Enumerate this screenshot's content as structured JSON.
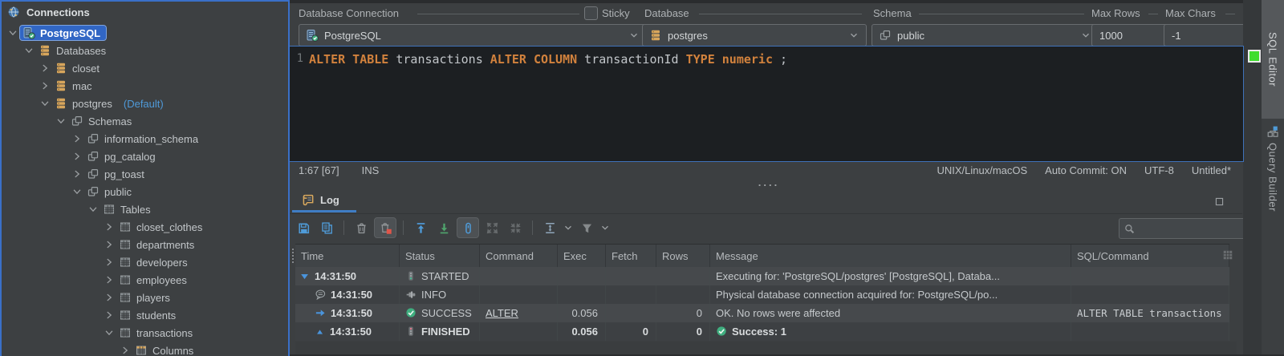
{
  "sidebar": {
    "title": "Connections",
    "tree": [
      {
        "label": "PostgreSQL",
        "indent": 0,
        "expand": "open",
        "icon": "connection",
        "selected": true
      },
      {
        "label": "Databases",
        "indent": 1,
        "expand": "open",
        "icon": "database"
      },
      {
        "label": "closet",
        "indent": 2,
        "expand": "closed",
        "icon": "database"
      },
      {
        "label": "mac",
        "indent": 2,
        "expand": "closed",
        "icon": "database"
      },
      {
        "label": "postgres",
        "indent": 2,
        "expand": "open",
        "icon": "database",
        "suffix": "(Default)"
      },
      {
        "label": "Schemas",
        "indent": 3,
        "expand": "open",
        "icon": "schema"
      },
      {
        "label": "information_schema",
        "indent": 4,
        "expand": "closed",
        "icon": "schema"
      },
      {
        "label": "pg_catalog",
        "indent": 4,
        "expand": "closed",
        "icon": "schema"
      },
      {
        "label": "pg_toast",
        "indent": 4,
        "expand": "closed",
        "icon": "schema"
      },
      {
        "label": "public",
        "indent": 4,
        "expand": "open",
        "icon": "schema"
      },
      {
        "label": "Tables",
        "indent": 5,
        "expand": "open",
        "icon": "table"
      },
      {
        "label": "closet_clothes",
        "indent": 6,
        "expand": "closed",
        "icon": "table"
      },
      {
        "label": "departments",
        "indent": 6,
        "expand": "closed",
        "icon": "table"
      },
      {
        "label": "developers",
        "indent": 6,
        "expand": "closed",
        "icon": "table"
      },
      {
        "label": "employees",
        "indent": 6,
        "expand": "closed",
        "icon": "table"
      },
      {
        "label": "players",
        "indent": 6,
        "expand": "closed",
        "icon": "table"
      },
      {
        "label": "students",
        "indent": 6,
        "expand": "closed",
        "icon": "table"
      },
      {
        "label": "transactions",
        "indent": 6,
        "expand": "open",
        "icon": "table"
      },
      {
        "label": "Columns",
        "indent": 7,
        "expand": "closed",
        "icon": "columns"
      }
    ]
  },
  "toolbar": {
    "connection_label": "Database Connection",
    "connection_value": "PostgreSQL",
    "sticky_label": "Sticky",
    "database_label": "Database",
    "database_value": "postgres",
    "schema_label": "Schema",
    "schema_value": "public",
    "max_rows_label": "Max Rows",
    "max_rows_value": "1000",
    "max_chars_label": "Max Chars",
    "max_chars_value": "-1"
  },
  "editor": {
    "line_number": "1",
    "sql_tokens": [
      {
        "text": "ALTER TABLE",
        "type": "keyword"
      },
      {
        "text": " transactions ",
        "type": "plain"
      },
      {
        "text": "ALTER COLUMN",
        "type": "keyword"
      },
      {
        "text": " transactionId ",
        "type": "plain"
      },
      {
        "text": "TYPE",
        "type": "keyword"
      },
      {
        "text": " numeric ",
        "type": "datatype"
      },
      {
        "text": ";",
        "type": "plain"
      }
    ],
    "status": {
      "position": "1:67 [67]",
      "mode": "INS",
      "right": [
        "UNIX/Linux/macOS",
        "Auto Commit: ON",
        "UTF-8",
        "Untitled*"
      ]
    }
  },
  "side_tabs": [
    {
      "label": "SQL Editor",
      "active": true
    },
    {
      "label": "Query Builder",
      "active": false
    }
  ],
  "log": {
    "tab_label": "Log",
    "search_value": "",
    "toolbar_icons": [
      {
        "name": "save"
      },
      {
        "name": "copy"
      },
      {
        "name": "divider"
      },
      {
        "name": "clear-log"
      },
      {
        "name": "clear-on-execute",
        "toggled": true
      },
      {
        "name": "divider"
      },
      {
        "name": "scroll-to-top"
      },
      {
        "name": "scroll-to-bottom"
      },
      {
        "name": "tail-log",
        "toggled": true
      },
      {
        "name": "expand-all",
        "disabled": true
      },
      {
        "name": "collapse-all",
        "disabled": true
      },
      {
        "name": "divider"
      },
      {
        "name": "fit-row-height",
        "chevron": true
      },
      {
        "name": "filter",
        "chevron": true
      }
    ],
    "columns": [
      "Time",
      "Status",
      "Command",
      "Exec",
      "Fetch",
      "Rows",
      "Message",
      "SQL/Command"
    ],
    "rows": [
      {
        "time": "14:31:50",
        "time_icon": "triangle-down",
        "child": false,
        "status": "STARTED",
        "status_icon": "traffic-started",
        "command": "",
        "exec": "",
        "fetch": "",
        "rows": "",
        "message": "Executing for: 'PostgreSQL/postgres' [PostgreSQL], Databa...",
        "sql": "",
        "bold": false
      },
      {
        "time": "14:31:50",
        "time_icon": "comment",
        "child": true,
        "status": "INFO",
        "status_icon": "plug",
        "command": "",
        "exec": "",
        "fetch": "",
        "rows": "",
        "message": "Physical database connection acquired for: PostgreSQL/po...",
        "sql": "",
        "bold": false
      },
      {
        "time": "14:31:50",
        "time_icon": "arrow-right",
        "child": true,
        "status": "SUCCESS",
        "status_icon": "check",
        "command": "ALTER",
        "exec": "0.056",
        "fetch": "",
        "rows": "0",
        "message": "OK. No rows were affected",
        "sql": "ALTER TABLE transactions",
        "bold": false
      },
      {
        "time": "14:31:50",
        "time_icon": "triangle-up",
        "child": true,
        "status": "FINISHED",
        "status_icon": "traffic-finished",
        "command": "",
        "exec": "0.056",
        "fetch": "0",
        "rows": "0",
        "message": "Success: 1",
        "message_icon": "check",
        "sql": "",
        "bold": true
      }
    ]
  }
}
